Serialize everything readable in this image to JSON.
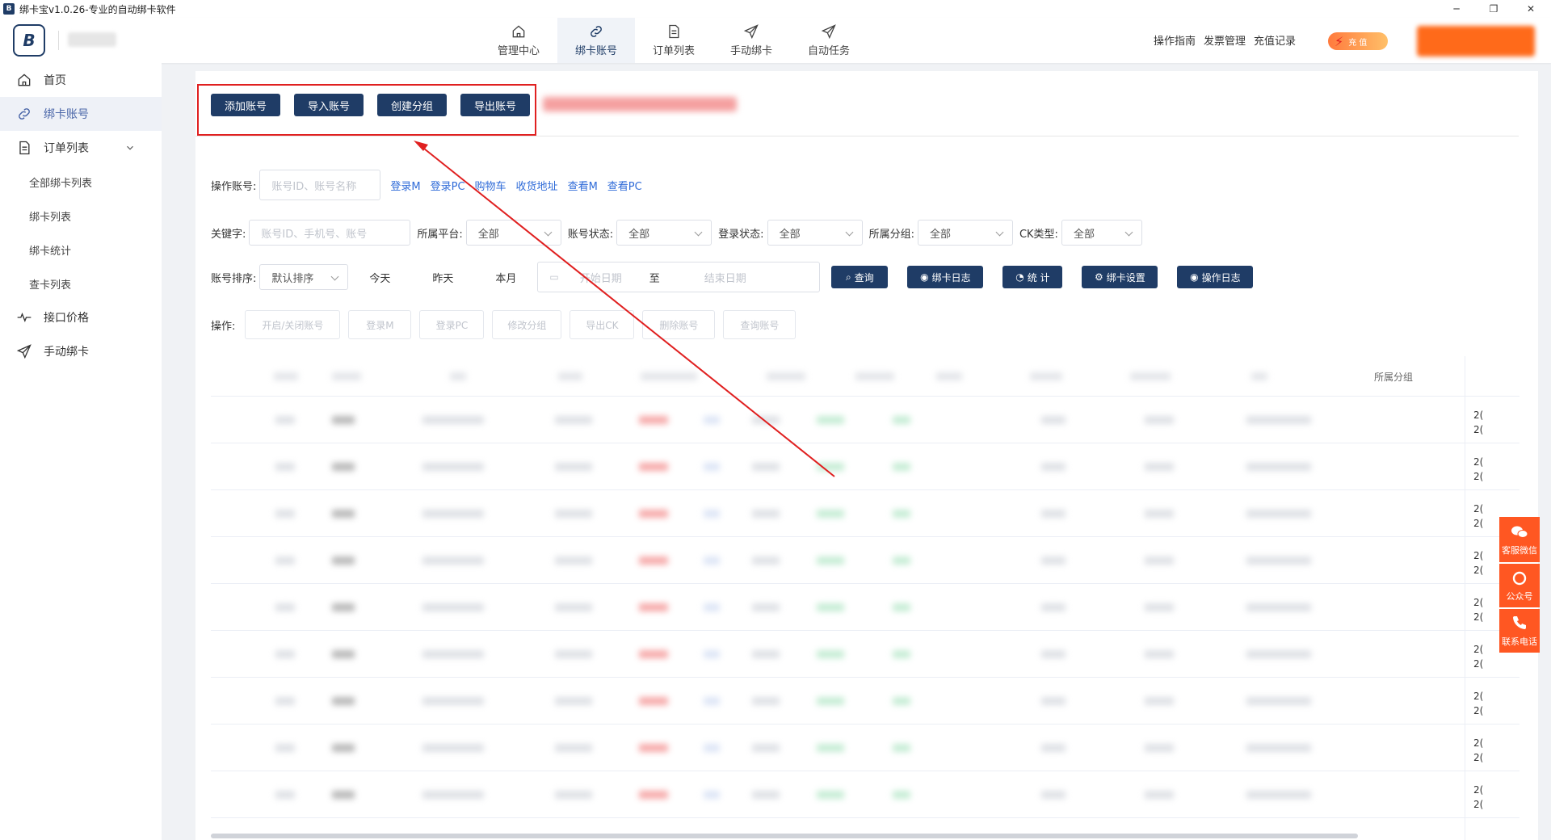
{
  "window": {
    "title": "绑卡宝v1.0.26-专业的自动绑卡软件",
    "logo": "B"
  },
  "header": {
    "nav": [
      {
        "label": "管理中心",
        "icon": "home-icon"
      },
      {
        "label": "绑卡账号",
        "icon": "link-icon",
        "active": true
      },
      {
        "label": "订单列表",
        "icon": "document-icon"
      },
      {
        "label": "手动绑卡",
        "icon": "send-icon"
      },
      {
        "label": "自动任务",
        "icon": "send-icon"
      }
    ],
    "links": [
      "操作指南",
      "发票管理",
      "充值记录"
    ],
    "recharge_label": "充 值"
  },
  "sidebar": {
    "items": [
      {
        "label": "首页",
        "icon": "home-icon"
      },
      {
        "label": "绑卡账号",
        "icon": "link-icon",
        "active": true
      },
      {
        "label": "订单列表",
        "icon": "document-icon"
      }
    ],
    "subitems": [
      "全部绑卡列表",
      "绑卡列表",
      "绑卡统计",
      "查卡列表"
    ],
    "bottom": [
      {
        "label": "接口价格",
        "icon": "pulse-icon"
      },
      {
        "label": "手动绑卡",
        "icon": "send-icon"
      }
    ]
  },
  "toolbar": {
    "buttons": [
      "添加账号",
      "导入账号",
      "创建分组",
      "导出账号"
    ]
  },
  "filters": {
    "op_account_label": "操作账号:",
    "op_account_placeholder": "账号ID、账号名称",
    "op_links": [
      "登录M",
      "登录PC",
      "购物车",
      "收货地址",
      "查看M",
      "查看PC"
    ],
    "keyword_label": "关键字:",
    "keyword_placeholder": "账号ID、手机号、账号",
    "platform_label": "所属平台:",
    "platform_value": "全部",
    "status_label": "账号状态:",
    "status_value": "全部",
    "login_label": "登录状态:",
    "login_value": "全部",
    "group_label": "所属分组:",
    "group_value": "全部",
    "ck_label": "CK类型:",
    "ck_value": "全部",
    "sort_label": "账号排序:",
    "sort_value": "默认排序",
    "days": [
      "今天",
      "昨天",
      "本月"
    ],
    "start_date": "开始日期",
    "to": "至",
    "end_date": "结束日期",
    "actions": [
      "查询",
      "绑卡日志",
      "统 计",
      "绑卡设置",
      "操作日志"
    ],
    "ops_label": "操作:",
    "ops": [
      "开启/关闭账号",
      "登录M",
      "登录PC",
      "修改分组",
      "导出CK",
      "删除账号",
      "查询账号"
    ]
  },
  "table": {
    "group_header": "所属分组",
    "fixed_col_text": "2("
  },
  "contact": [
    {
      "label": "客服微信",
      "icon": "wechat-icon"
    },
    {
      "label": "公众号",
      "icon": "official-account-icon"
    },
    {
      "label": "联系电话",
      "icon": "phone-icon"
    }
  ],
  "colors": {
    "primary": "#1f3c66",
    "accent_red": "#e02020",
    "contact_orange": "#ff5722"
  }
}
